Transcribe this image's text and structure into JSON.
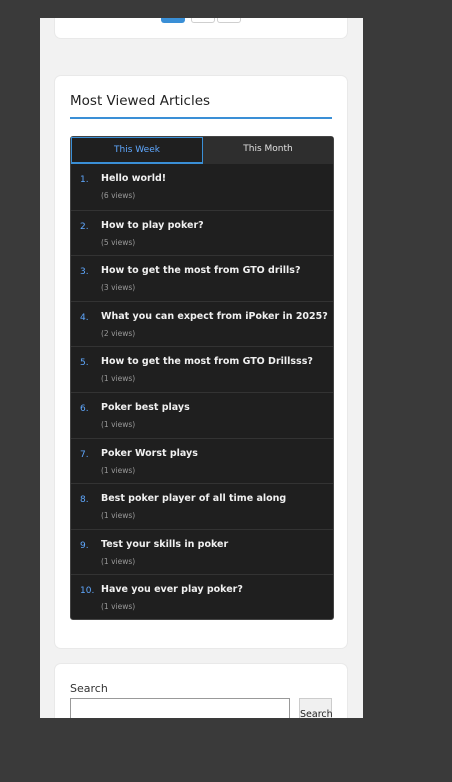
{
  "most_viewed": {
    "title": "Most Viewed Articles",
    "tabs": [
      {
        "label": "This Week",
        "active": true
      },
      {
        "label": "This Month",
        "active": false
      }
    ],
    "articles": [
      {
        "num": "1.",
        "title": "Hello world!",
        "views": "(6 views)"
      },
      {
        "num": "2.",
        "title": "How to play poker?",
        "views": "(5 views)"
      },
      {
        "num": "3.",
        "title": "How to get the most from GTO drills?",
        "views": "(3 views)"
      },
      {
        "num": "4.",
        "title": "What you can expect from iPoker in 2025?",
        "views": "(2 views)"
      },
      {
        "num": "5.",
        "title": "How to get the most from GTO Drillsss?",
        "views": "(1 views)"
      },
      {
        "num": "6.",
        "title": "Poker best plays",
        "views": "(1 views)"
      },
      {
        "num": "7.",
        "title": "Poker Worst plays",
        "views": "(1 views)"
      },
      {
        "num": "8.",
        "title": "Best poker player of all time along",
        "views": "(1 views)"
      },
      {
        "num": "9.",
        "title": "Test your skills in poker",
        "views": "(1 views)"
      },
      {
        "num": "10.",
        "title": "Have you ever play poker?",
        "views": "(1 views)"
      }
    ]
  },
  "search": {
    "label": "Search",
    "input_value": "",
    "button_label": "Search"
  },
  "colors": {
    "accent": "#3a8fd6",
    "panel_bg": "#1f1f1f",
    "link_blue": "#5fa8ff"
  }
}
